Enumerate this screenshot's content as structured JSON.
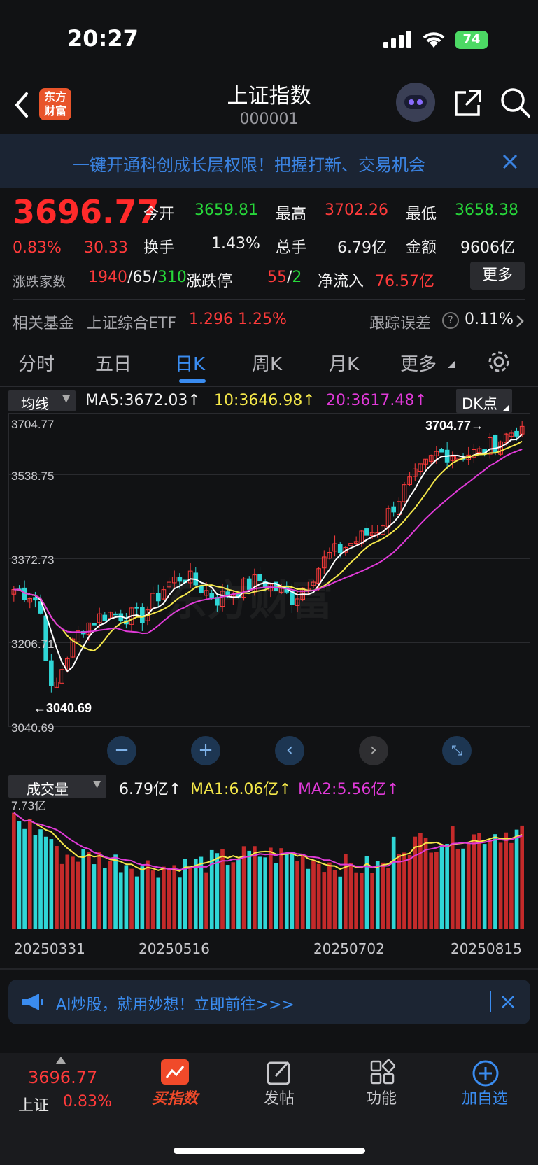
{
  "status_bar": {
    "time": "20:27",
    "battery": "74"
  },
  "header": {
    "logo": "东方财富",
    "title": "上证指数",
    "code": "000001"
  },
  "banner": {
    "text": "一键开通科创成长层权限！把握打新、交易机会"
  },
  "quote": {
    "price": "3696.77",
    "change_pct": "0.83%",
    "change": "30.33",
    "open_label": "今开",
    "open": "3659.81",
    "high_label": "最高",
    "high": "3702.26",
    "low_label": "最低",
    "low": "3658.38",
    "turnover_label": "换手",
    "turnover": "1.43%",
    "volume_label": "总手",
    "volume": "6.79亿",
    "amount_label": "金额",
    "amount": "9606亿",
    "breadth_label": "涨跌家数",
    "up": "1940",
    "sep1": "/",
    "flat": "65",
    "sep2": "/",
    "down": "310",
    "limit_label": "涨跌停",
    "limit_up": "55",
    "sep3": "/",
    "limit_down": "2",
    "inflow_label": "净流入",
    "inflow": "76.57亿",
    "more": "更多"
  },
  "fund": {
    "label": "相关基金",
    "name": "上证综合ETF",
    "price": "1.296",
    "pct": "1.25%",
    "tracking_label": "跟踪误差",
    "tracking": "0.11%"
  },
  "tabs": [
    "分时",
    "五日",
    "日K",
    "周K",
    "月K",
    "更多"
  ],
  "active_tab": "日K",
  "kline": {
    "ma_select": "均线",
    "ma5": "MA5:3672.03↑",
    "ma10": "10:3646.98↑",
    "ma20": "20:3617.48↑",
    "dk": "DK点",
    "y_labels": [
      "3704.77",
      "3538.75",
      "3372.73",
      "3206.71",
      "3040.69"
    ],
    "max_marker": "3704.77→",
    "min_marker": "←3040.69"
  },
  "volume": {
    "select": "成交量",
    "vol": "6.79亿↑",
    "ma1": "MA1:6.06亿↑",
    "ma2": "MA2:5.56亿↑",
    "max_label": "7.73亿"
  },
  "dates": [
    "20250331",
    "20250516",
    "20250702",
    "20250815"
  ],
  "ai_banner": {
    "text": "AI炒股，就用妙想！立即前往>>>"
  },
  "bottom": {
    "price": "3696.77",
    "name": "上证",
    "pct": "0.83%",
    "buy": "买指数",
    "post": "发帖",
    "func": "功能",
    "add": "加自选"
  },
  "colors": {
    "up": "#ff3b3b",
    "down": "#27d83a",
    "accent": "#3a8cf0",
    "ma5": "#ffffff",
    "ma10": "#f5e84a",
    "ma20": "#e03ad8",
    "bar_down": "#2fd6d6"
  }
}
